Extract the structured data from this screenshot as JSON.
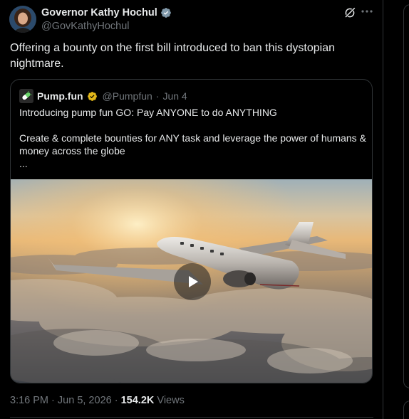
{
  "author": {
    "name": "Governor Kathy Hochul",
    "handle": "@GovKathyHochul",
    "verified": "gray-check-badge"
  },
  "tweet": {
    "text": "Offering a bounty on the first bill introduced to ban this dystopian nightmare."
  },
  "quoted": {
    "name": "Pump.fun",
    "handle": "@Pumpfun",
    "separator": "·",
    "date": "Jun 4",
    "line1": "Introducing pump fun GO: Pay ANYONE to do ANYTHING",
    "line2": "Create & complete bounties for ANY task and leverage the power of humans & money across the globe",
    "line3": "...",
    "verified": "gold-check-badge",
    "media_label": "private jet above clouds video"
  },
  "meta": {
    "time": "3:16 PM",
    "sep1": "·",
    "date": "Jun 5, 2026",
    "sep2": "·",
    "views": "154.2K",
    "views_label": "Views"
  },
  "colors": {
    "background": "#000000",
    "text": "#e7e9ea",
    "muted": "#71767b",
    "border": "#2f3336",
    "gold": "#e2b719"
  }
}
